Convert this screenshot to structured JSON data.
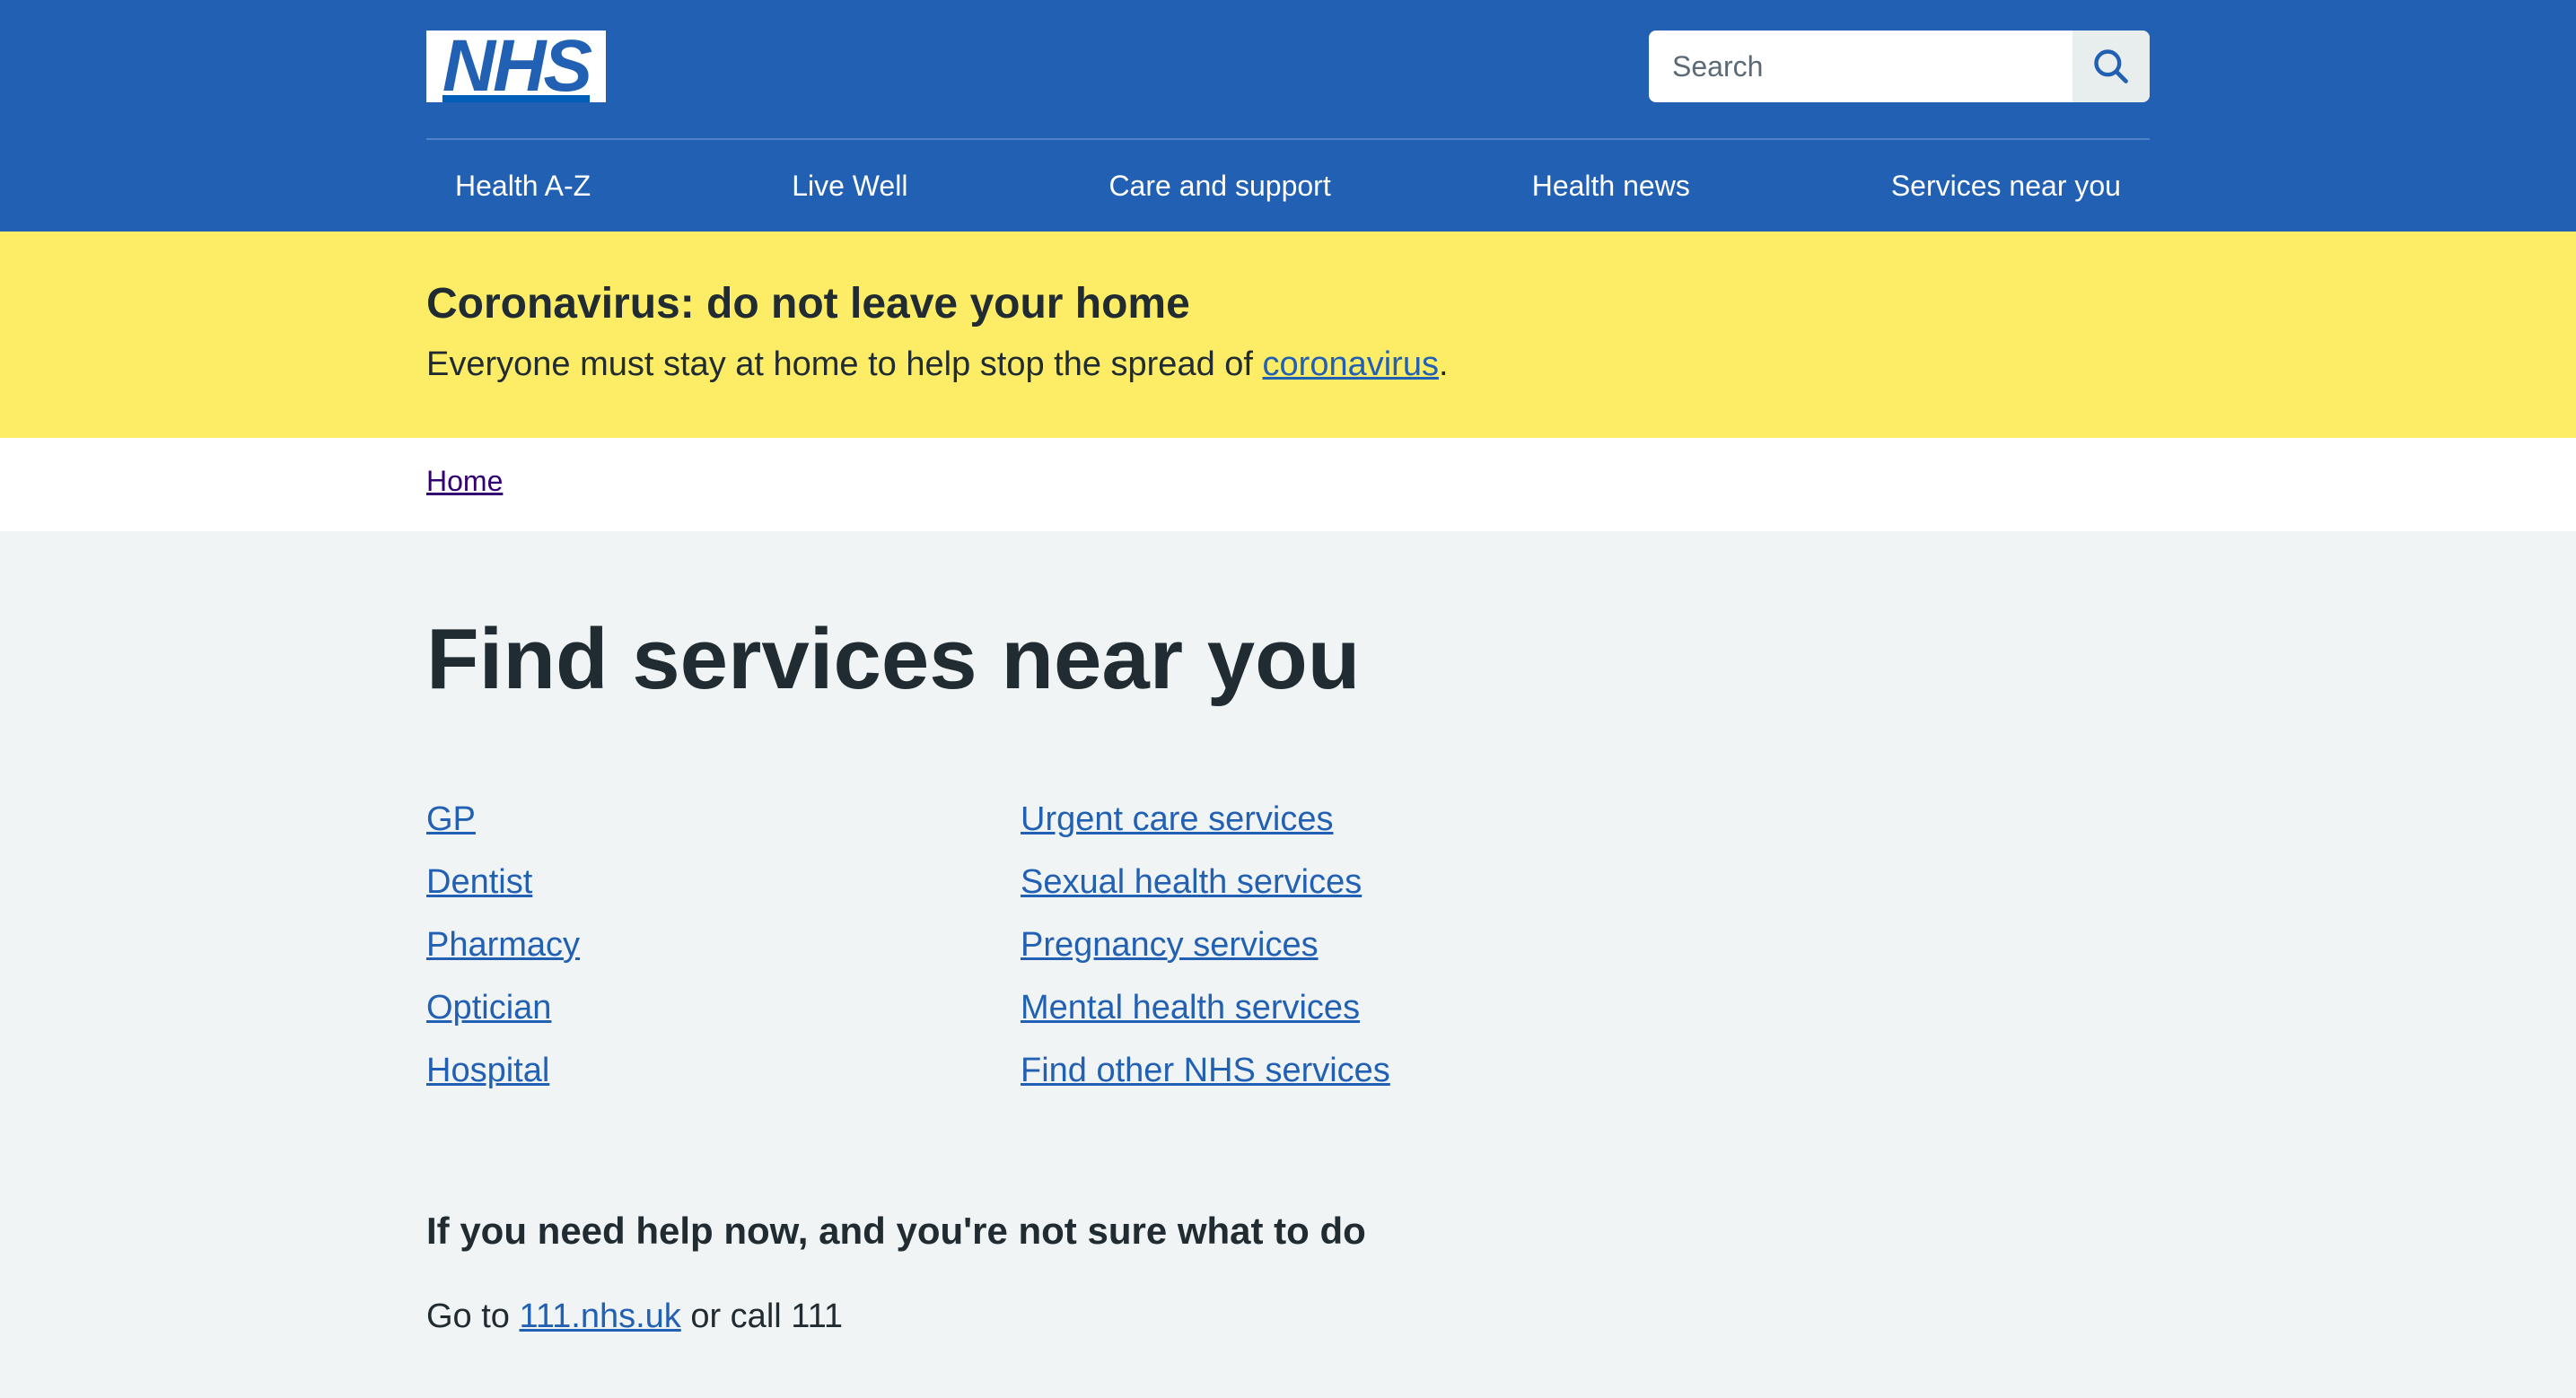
{
  "header": {
    "logo_text": "NHS",
    "search_placeholder": "Search",
    "search_icon": "search-icon",
    "nav": [
      "Health A-Z",
      "Live Well",
      "Care and support",
      "Health news",
      "Services near you"
    ]
  },
  "alert": {
    "title": "Coronavirus: do not leave your home",
    "text_before": "Everyone must stay at home to help stop the spread of ",
    "link": "coronavirus",
    "text_after": "."
  },
  "breadcrumb": {
    "home": "Home"
  },
  "main": {
    "title": "Find services near you",
    "left_links": [
      "GP",
      "Dentist",
      "Pharmacy",
      "Optician",
      "Hospital"
    ],
    "right_links": [
      "Urgent care services",
      "Sexual health services",
      "Pregnancy services",
      "Mental health services",
      "Find other NHS services"
    ],
    "help_heading": "If you need help now, and you're not sure what to do",
    "help_prefix": "Go to ",
    "help_link": "111.nhs.uk",
    "help_suffix": " or call 111"
  },
  "colors": {
    "header_blue": "#2160b2",
    "alert_yellow": "#fded66",
    "page_bg": "#f0f4f5",
    "link_blue": "#2160b2",
    "visited_purple": "#330072"
  }
}
